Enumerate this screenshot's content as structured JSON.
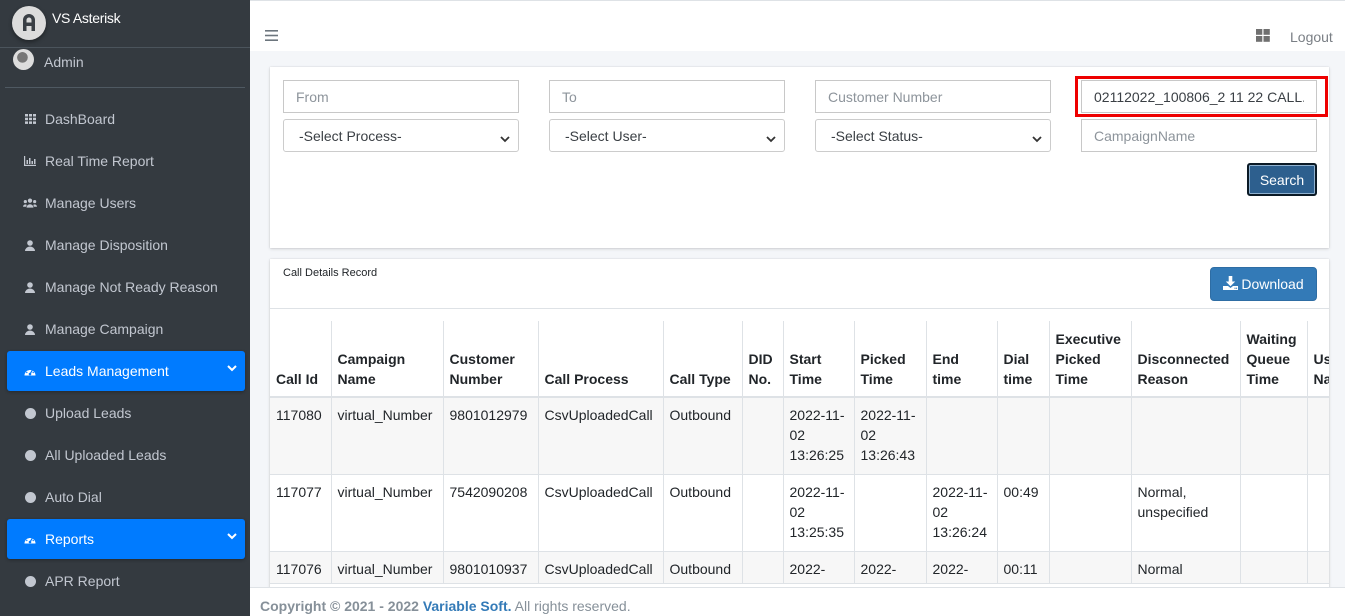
{
  "app": {
    "title": "VS Asterisk"
  },
  "user": {
    "name": "Admin"
  },
  "sidebar": {
    "items": [
      {
        "label": "DashBoard",
        "icon": "grid-icon",
        "type": "link"
      },
      {
        "label": "Real Time Report",
        "icon": "chart-icon",
        "type": "link"
      },
      {
        "label": "Manage Users",
        "icon": "users-icon",
        "type": "link"
      },
      {
        "label": "Manage Disposition",
        "icon": "user-icon",
        "type": "link"
      },
      {
        "label": "Manage Not Ready Reason",
        "icon": "user-icon",
        "type": "link"
      },
      {
        "label": "Manage Campaign",
        "icon": "user-icon",
        "type": "link"
      },
      {
        "label": "Leads Management",
        "icon": "dashboard-gauge-icon",
        "type": "group",
        "expanded": true
      },
      {
        "label": "Upload Leads",
        "icon": "circle-icon",
        "type": "sublink"
      },
      {
        "label": "All Uploaded Leads",
        "icon": "circle-icon",
        "type": "sublink"
      },
      {
        "label": "Auto Dial",
        "icon": "circle-icon",
        "type": "sublink"
      },
      {
        "label": "Reports",
        "icon": "dashboard-gauge-icon",
        "type": "group",
        "expanded": true
      },
      {
        "label": "APR Report",
        "icon": "circle-icon",
        "type": "sublink"
      }
    ]
  },
  "topbar": {
    "logout_label": "Logout"
  },
  "filters": {
    "from": {
      "placeholder": "From",
      "value": ""
    },
    "to": {
      "placeholder": "To",
      "value": ""
    },
    "customer_number": {
      "placeholder": "Customer Number",
      "value": ""
    },
    "file_name": {
      "placeholder": "",
      "value": "02112022_100806_2 11 22 CALL."
    },
    "process_select": {
      "selected": "-Select Process-"
    },
    "user_select": {
      "selected": "-Select User-"
    },
    "status_select": {
      "selected": "-Select Status-"
    },
    "campaign_name": {
      "placeholder": "CampaignName",
      "value": ""
    },
    "search_label": "Search"
  },
  "table_card": {
    "title": "Call Details Record",
    "download_label": "Download",
    "columns": [
      "Call Id",
      "Campaign Name",
      "Customer Number",
      "Call Process",
      "Call Type",
      "DID No.",
      "Start Time",
      "Picked Time",
      "End time",
      "Dial time",
      "Executive Picked Time",
      "Disconnected Reason",
      "Waiting Queue Time",
      "User Name"
    ],
    "rows": [
      [
        "117080",
        "virtual_Number",
        "9801012979",
        "CsvUploadedCall",
        "Outbound",
        "",
        "2022-11-02 13:26:25",
        "2022-11-02 13:26:43",
        "",
        "",
        "",
        "",
        "",
        ""
      ],
      [
        "117077",
        "virtual_Number",
        "7542090208",
        "CsvUploadedCall",
        "Outbound",
        "",
        "2022-11-02 13:25:35",
        "",
        "2022-11-02 13:26:24",
        "00:49",
        "",
        "Normal, unspecified",
        "",
        ""
      ],
      [
        "117076",
        "virtual_Number",
        "9801010937",
        "CsvUploadedCall",
        "Outbound",
        "",
        "2022-",
        "2022-",
        "2022-",
        "00:11",
        "",
        "Normal",
        "",
        ""
      ]
    ]
  },
  "footer": {
    "prefix": "Copyright © 2021 - 2022",
    "company": "Variable Soft.",
    "suffix": "All rights reserved."
  },
  "colors": {
    "sidebar_bg": "#343a40",
    "active_nav": "#007bff",
    "download_btn": "#337ab7",
    "search_btn": "#2d5f8e",
    "highlight": "#ee0000"
  }
}
